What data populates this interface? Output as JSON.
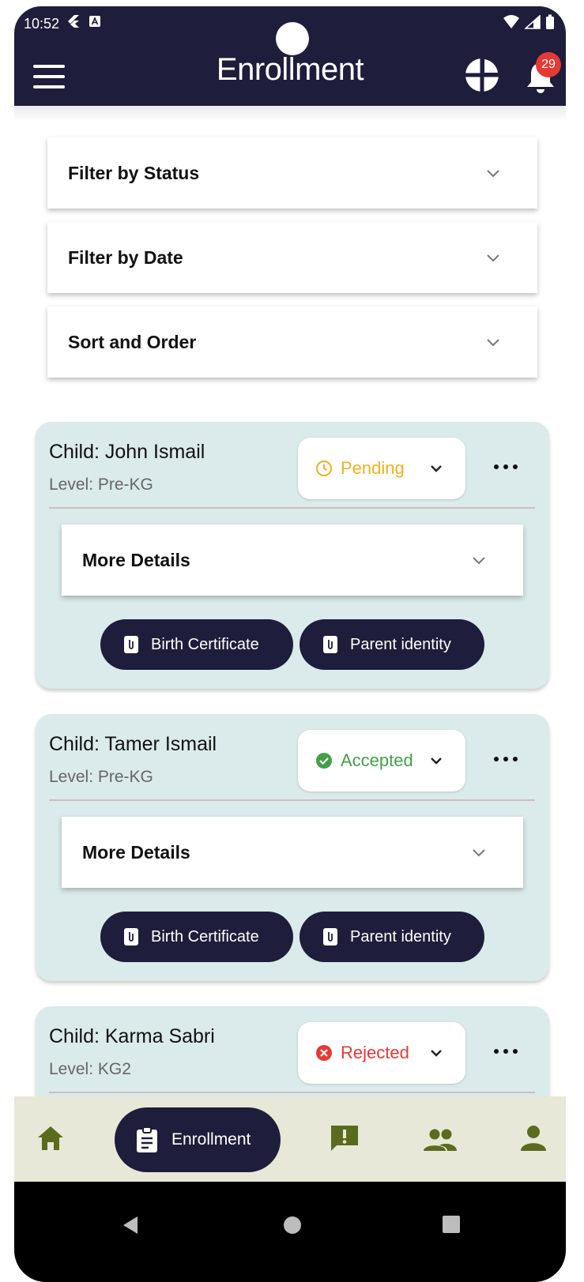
{
  "status_bar": {
    "time": "10:52"
  },
  "header": {
    "title": "Enrollment",
    "notification_count": "29"
  },
  "filters": [
    {
      "label": "Filter by Status"
    },
    {
      "label": "Filter by Date"
    },
    {
      "label": "Sort and Order"
    }
  ],
  "enrollments": [
    {
      "child": "Child: John Ismail",
      "level": "Level: Pre-KG",
      "status": "Pending",
      "status_color": "#f2b01e",
      "details_label": "More Details",
      "doc1": "Birth Certificate",
      "doc2": "Parent identity"
    },
    {
      "child": "Child: Tamer Ismail",
      "level": "Level: Pre-KG",
      "status": "Accepted",
      "status_color": "#43a047",
      "details_label": "More Details",
      "doc1": "Birth Certificate",
      "doc2": "Parent identity"
    },
    {
      "child": "Child: Karma Sabri",
      "level": "Level: KG2",
      "status": "Rejected",
      "status_color": "#e53935"
    }
  ],
  "bottom_nav": {
    "active_label": "Enrollment",
    "icon_color": "#5a6b1e",
    "items": [
      "home-icon",
      "enrollment-icon",
      "report-icon",
      "people-icon",
      "person-icon"
    ]
  },
  "colors": {
    "primary": "#1e1d3b",
    "card_bg": "#dbeaea",
    "nav_bg": "#e8e8d8"
  }
}
